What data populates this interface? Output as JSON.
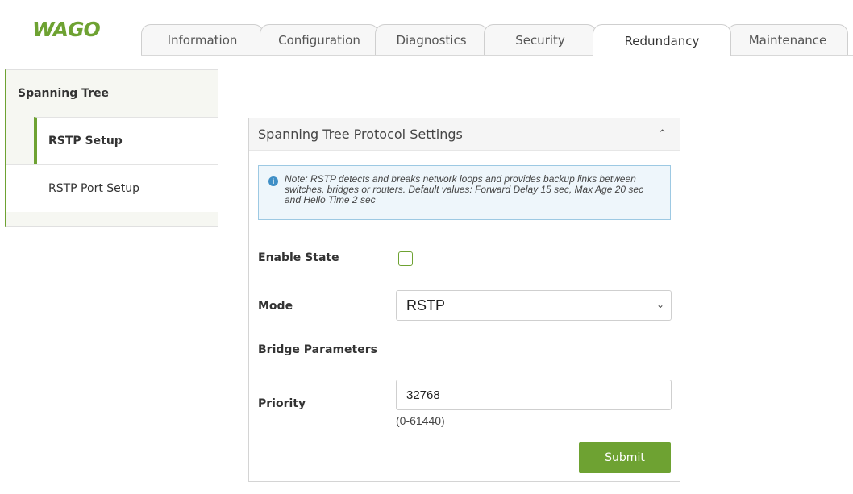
{
  "brand": {
    "logo_text": "WAGO",
    "accent_color": "#6ea232"
  },
  "tabs": [
    {
      "label": "Information",
      "active": false
    },
    {
      "label": "Configuration",
      "active": false
    },
    {
      "label": "Diagnostics",
      "active": false
    },
    {
      "label": "Security",
      "active": false
    },
    {
      "label": "Redundancy",
      "active": true
    },
    {
      "label": "Maintenance",
      "active": false
    }
  ],
  "sidebar": {
    "group_label": "Spanning Tree",
    "items": [
      {
        "label": "RSTP Setup",
        "active": true
      },
      {
        "label": "RSTP Port Setup",
        "active": false
      }
    ]
  },
  "panel": {
    "title": "Spanning Tree Protocol Settings",
    "collapse_icon": "chevron-up-icon",
    "note": "Note: RSTP detects and breaks network loops and provides backup links between switches, bridges or routers. Default values: Forward Delay 15 sec, Max Age 20 sec and Hello Time 2 sec",
    "enable_state_label": "Enable State",
    "enable_state_checked": false,
    "mode_label": "Mode",
    "mode_value": "RSTP",
    "bridge_section_label": "Bridge Parameters",
    "priority_label": "Priority",
    "priority_value": "32768",
    "priority_range": "(0-61440)",
    "submit_label": "Submit"
  }
}
